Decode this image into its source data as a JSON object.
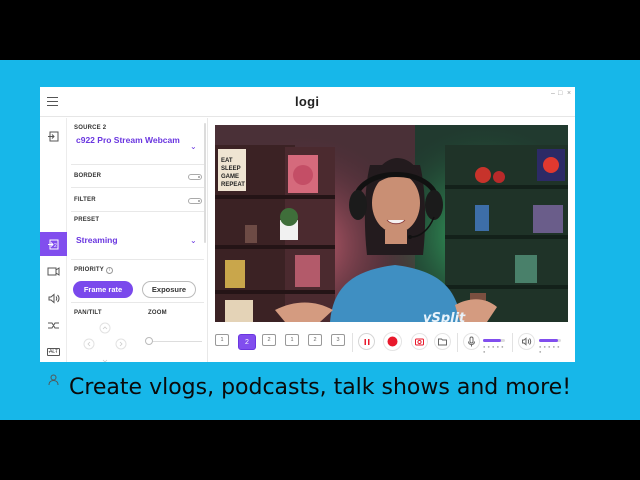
{
  "app": {
    "logo": "logi",
    "window_controls": [
      "–",
      "□",
      "×"
    ]
  },
  "rail": {
    "items": [
      {
        "icon": "source-1-icon",
        "active": false
      },
      {
        "icon": "source-2-icon",
        "active": true
      },
      {
        "icon": "camera-icon",
        "active": false
      },
      {
        "icon": "speaker-icon",
        "active": false
      },
      {
        "icon": "transitions-icon",
        "active": false
      },
      {
        "icon": "alt-text-icon",
        "label": "ALT",
        "active": false
      },
      {
        "icon": "user-icon",
        "active": false
      }
    ],
    "more": "..."
  },
  "panel": {
    "source_label": "SOURCE 2",
    "source_value": "c922 Pro Stream Webcam",
    "border_label": "BORDER",
    "filter_label": "FILTER",
    "preset_label": "PRESET",
    "preset_value": "Streaming",
    "priority_label": "PRIORITY",
    "priority_info": "i",
    "priority_options": [
      "Frame rate",
      "Exposure"
    ],
    "priority_selected": "Frame rate",
    "pan_tilt_label": "PAN/TILT",
    "zoom_label": "ZOOM"
  },
  "toolbar": {
    "scenes": [
      "1",
      "2",
      "2",
      "1",
      "2",
      "3"
    ],
    "active_scene": 2,
    "pause_icon": "pause-icon",
    "record_icon": "record-icon",
    "snapshot_icon": "camera-icon",
    "folder_icon": "folder-icon",
    "mic_icon": "microphone-icon",
    "speaker_icon": "speaker-icon",
    "mic_level": 0.8,
    "speaker_level": 0.85
  },
  "video": {
    "poster_text": "EAT SLEEP GAME REPEAT",
    "shirt_text": "vSplit"
  },
  "caption": "Create vlogs, podcasts, talk shows and more!",
  "colors": {
    "background": "#17b7e9",
    "accent": "#814eee",
    "record": "#e8192c"
  }
}
